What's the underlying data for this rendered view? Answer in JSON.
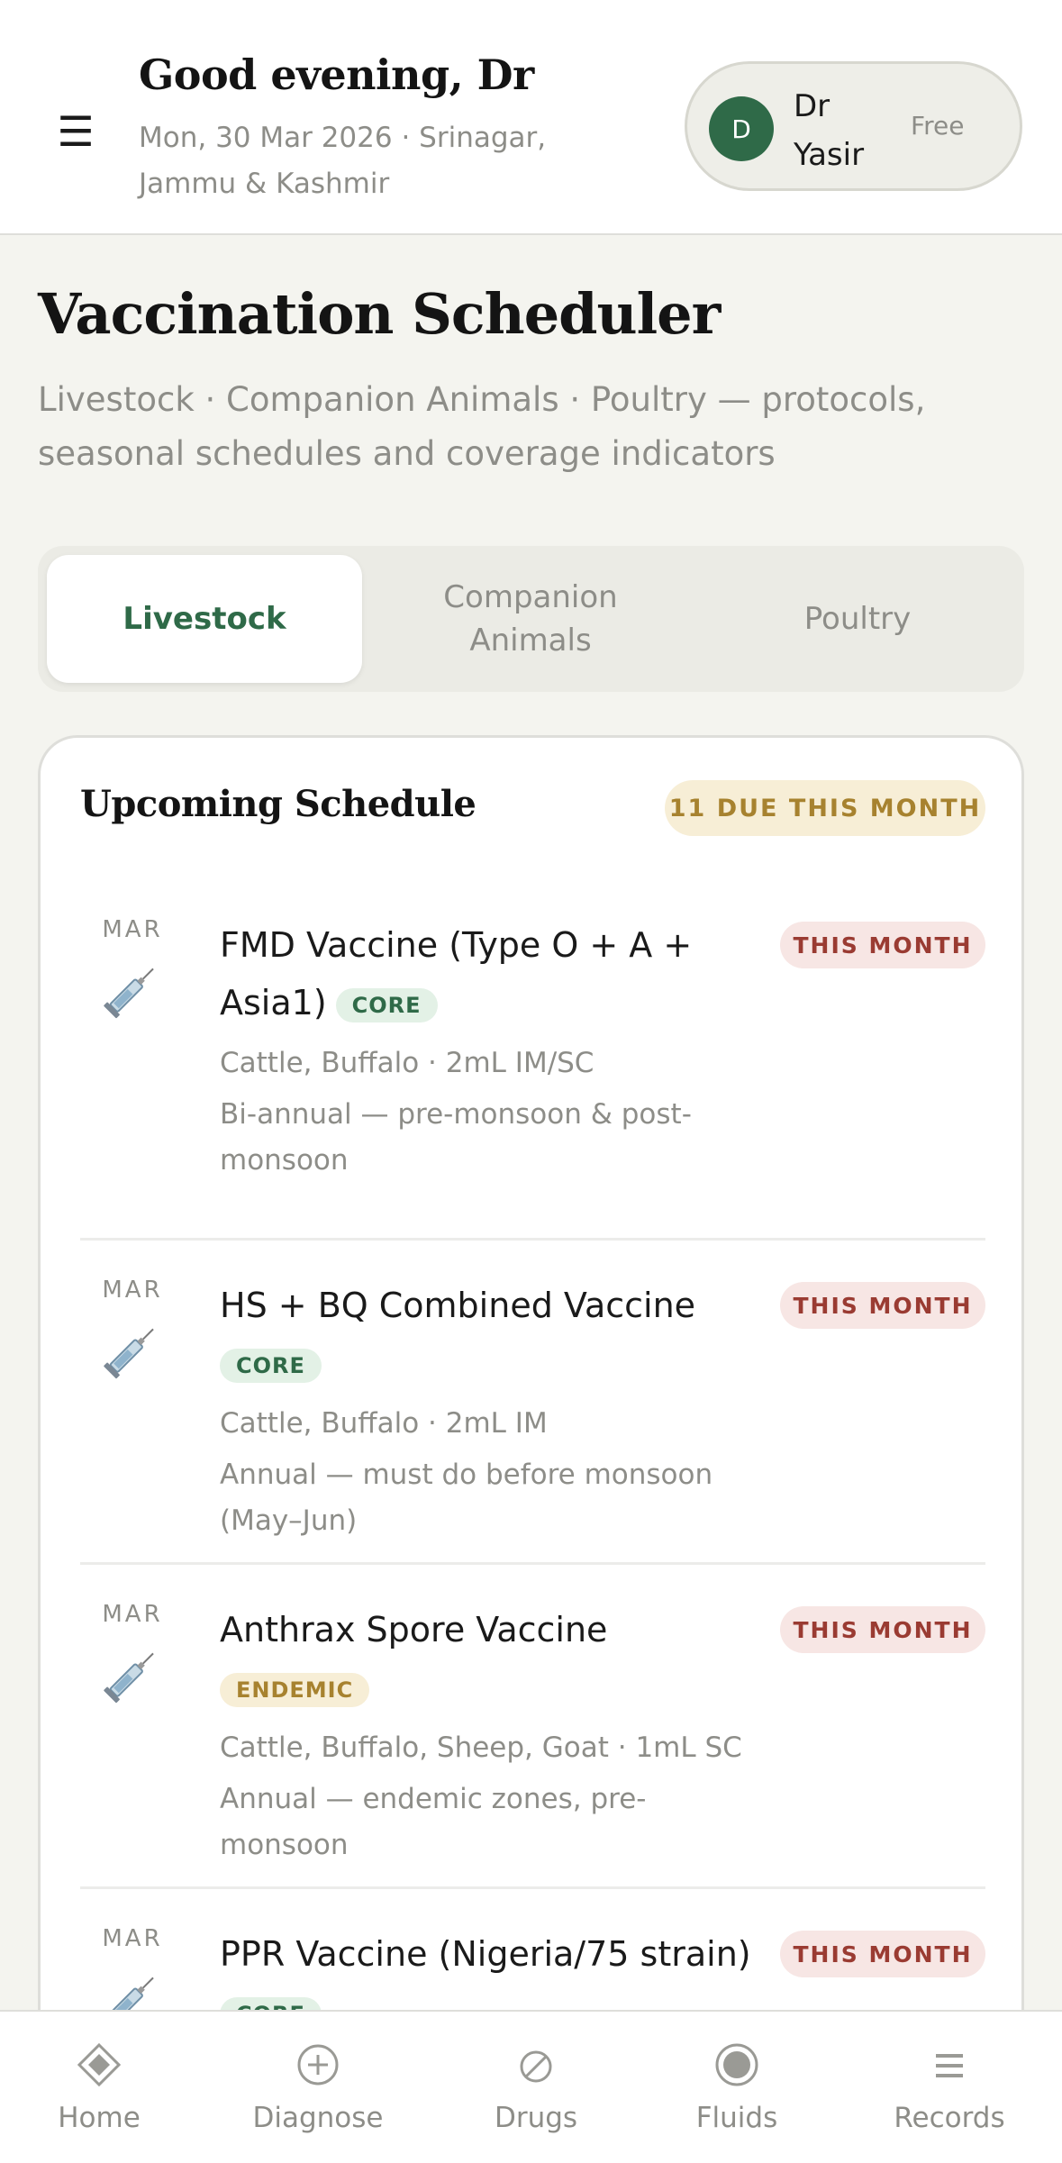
{
  "header": {
    "menu_icon": "menu-icon",
    "greeting": "Good evening, Dr",
    "date_location": "Mon, 30 Mar 2026 · Srinagar, Jammu & Kashmir",
    "user": {
      "avatar_initial": "D",
      "name": "Dr Yasir",
      "plan": "Free"
    }
  },
  "page": {
    "title": "Vaccination Scheduler",
    "description": "Livestock · Companion Animals · Poultry — protocols, seasonal schedules and coverage indicators"
  },
  "tabs": [
    {
      "label": "Livestock",
      "active": true
    },
    {
      "label": "Companion Animals",
      "active": false
    },
    {
      "label": "Poultry",
      "active": false
    }
  ],
  "schedule": {
    "title": "Upcoming Schedule",
    "due_badge": "11 DUE THIS MONTH",
    "items": [
      {
        "month": "MAR",
        "icon": "syringe-icon",
        "name": "FMD Vaccine (Type O + A + Asia1)",
        "tag": "CORE",
        "species_dose": "Cattle, Buffalo · 2mL IM/SC",
        "frequency": "Bi-annual — pre-monsoon & post-monsoon",
        "status": "THIS MONTH"
      },
      {
        "month": "MAR",
        "icon": "syringe-icon",
        "name": "HS + BQ Combined Vaccine",
        "tag": "CORE",
        "species_dose": "Cattle, Buffalo · 2mL IM",
        "frequency": "Annual — must do before monsoon (May–Jun)",
        "status": "THIS MONTH"
      },
      {
        "month": "MAR",
        "icon": "syringe-icon",
        "name": "Anthrax Spore Vaccine",
        "tag": "ENDEMIC",
        "species_dose": "Cattle, Buffalo, Sheep, Goat · 1mL SC",
        "frequency": "Annual — endemic zones, pre-monsoon",
        "status": "THIS MONTH"
      },
      {
        "month": "MAR",
        "icon": "syringe-icon",
        "name": "PPR Vaccine (Nigeria/75 strain)",
        "tag": "CORE",
        "status": "THIS MONTH"
      }
    ]
  },
  "bottom_nav": [
    {
      "label": "Home",
      "icon": "home-icon",
      "active": false
    },
    {
      "label": "Diagnose",
      "icon": "diagnose-plus-icon",
      "active": false
    },
    {
      "label": "Drugs",
      "icon": "drugs-pill-icon",
      "active": false
    },
    {
      "label": "Fluids",
      "icon": "fluids-drop-icon",
      "active": false
    },
    {
      "label": "Records",
      "icon": "records-list-icon",
      "active": false
    }
  ],
  "colors": {
    "brand_green": "#2f6a48",
    "status_red": "#9a3b32",
    "status_red_bg": "#f7e6e4",
    "endemic_gold": "#a7822f",
    "endemic_bg": "#f7eed6",
    "core_bg": "#e3f1e6",
    "muted_text": "#8d8d88",
    "page_bg": "#f4f4ef"
  }
}
